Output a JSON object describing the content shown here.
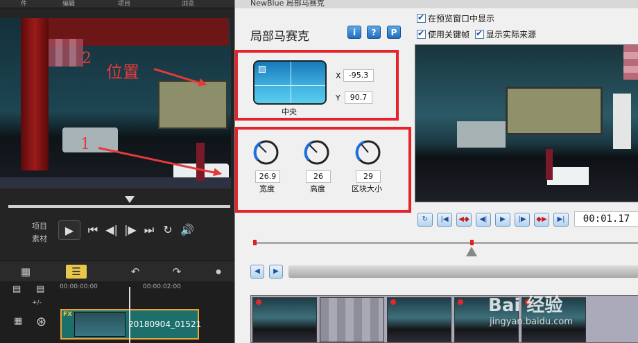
{
  "host": {
    "menu_items": [
      "件",
      "编辑",
      "项目",
      "浏览"
    ],
    "annotations": {
      "num2": "2",
      "position_label": "位置",
      "num1": "1"
    },
    "mode_labels": {
      "project": "项目",
      "clip": "素材"
    },
    "ruler": {
      "t0": "00:00:00:00",
      "t2": "00:00:02:00"
    },
    "track_label": "+/-",
    "clip": {
      "name": "20180904_01521",
      "fx": "FX"
    },
    "icons": [
      "play-icon",
      "previous-icon",
      "step-back-icon",
      "step-forward-icon",
      "next-icon",
      "loop-icon",
      "volume-icon"
    ]
  },
  "dialog": {
    "window_title": "NewBlue 局部马赛克",
    "heading": "局部马赛克",
    "help_buttons": [
      "i",
      "?",
      "P"
    ],
    "checkboxes": [
      {
        "label": "在预览窗口中显示",
        "checked": true
      },
      {
        "label": "使用关键帧",
        "checked": true
      },
      {
        "label": "显示实际来源",
        "checked": true
      }
    ],
    "position": {
      "center_label": "中央",
      "x_label": "X",
      "x_value": "-95.3",
      "y_label": "Y",
      "y_value": "90.7"
    },
    "knobs": [
      {
        "value": "26.9",
        "label": "宽度"
      },
      {
        "value": "26",
        "label": "高度"
      },
      {
        "value": "29",
        "label": "区块大小"
      }
    ],
    "timecode": "00:01.17"
  },
  "watermark": {
    "logo": "Bai 经验",
    "url": "jingyan.baidu.com"
  },
  "colors": {
    "accent_red": "#e8222a",
    "knob_blue": "#1e6fd9",
    "clip_teal": "#1d6f6c"
  }
}
